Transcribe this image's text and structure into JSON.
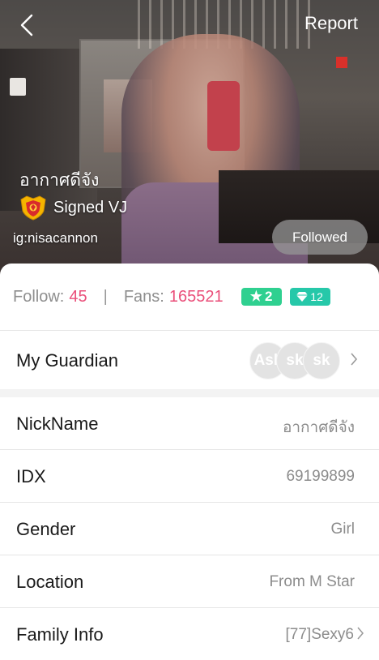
{
  "header": {
    "report_label": "Report",
    "nickname": "อากาศดีจัง",
    "badge_label": "Signed VJ",
    "instagram": "ig:nisacannon",
    "followed_label": "Followed"
  },
  "stats": {
    "follow_label": "Follow:",
    "follow_count": "45",
    "separator": "|",
    "fans_label": "Fans:",
    "fans_count": "165521",
    "star_level": "2",
    "diamond_level": "12"
  },
  "guardian": {
    "label": "My Guardian",
    "avatars": [
      "Ask",
      "sk",
      "sk"
    ]
  },
  "info": [
    {
      "label": "NickName",
      "value": "อากาศดีจัง"
    },
    {
      "label": "IDX",
      "value": "69199899"
    },
    {
      "label": "Gender",
      "value": "Girl"
    },
    {
      "label": "Location",
      "value": "From M Star"
    },
    {
      "label": "Family Info",
      "value": "[77]Sexy6"
    }
  ],
  "colors": {
    "accent_pink": "#ea4f7a",
    "star_pill": "#2fd090",
    "diamond_pill": "#26c8a9"
  }
}
